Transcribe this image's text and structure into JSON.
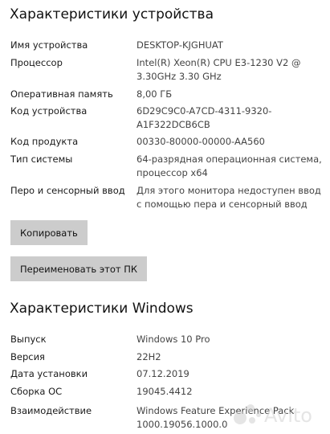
{
  "device": {
    "title": "Характеристики устройства",
    "rows": [
      {
        "label": "Имя устройства",
        "value": "DESKTOP-KJGHUAT"
      },
      {
        "label": "Процессор",
        "value": "Intel(R) Xeon(R) CPU E3-1230 V2 @ 3.30GHz   3.30 GHz"
      },
      {
        "label": "Оперативная память",
        "value": "8,00 ГБ"
      },
      {
        "label": "Код устройства",
        "value": "6D29C9C0-A7CD-4311-9320-A1F322DCB6CB"
      },
      {
        "label": "Код продукта",
        "value": "00330-80000-00000-AA560"
      },
      {
        "label": "Тип системы",
        "value": "64-разрядная операционная система, процессор x64"
      },
      {
        "label": "Перо и сенсорный ввод",
        "value": "Для этого монитора недоступен ввод с помощью пера и сенсорный ввод"
      }
    ],
    "copy_button": "Копировать",
    "rename_button": "Переименовать этот ПК"
  },
  "windows": {
    "title": "Характеристики Windows",
    "rows": [
      {
        "label": "Выпуск",
        "value": "Windows 10 Pro"
      },
      {
        "label": "Версия",
        "value": "22H2"
      },
      {
        "label": "Дата установки",
        "value": "07.12.2019"
      },
      {
        "label": "Сборка ОС",
        "value": "19045.4412"
      },
      {
        "label": "Взаимодействие",
        "value": "Windows Feature Experience Pack 1000.19056.1000.0"
      }
    ]
  },
  "watermark": {
    "text": "Avito"
  }
}
